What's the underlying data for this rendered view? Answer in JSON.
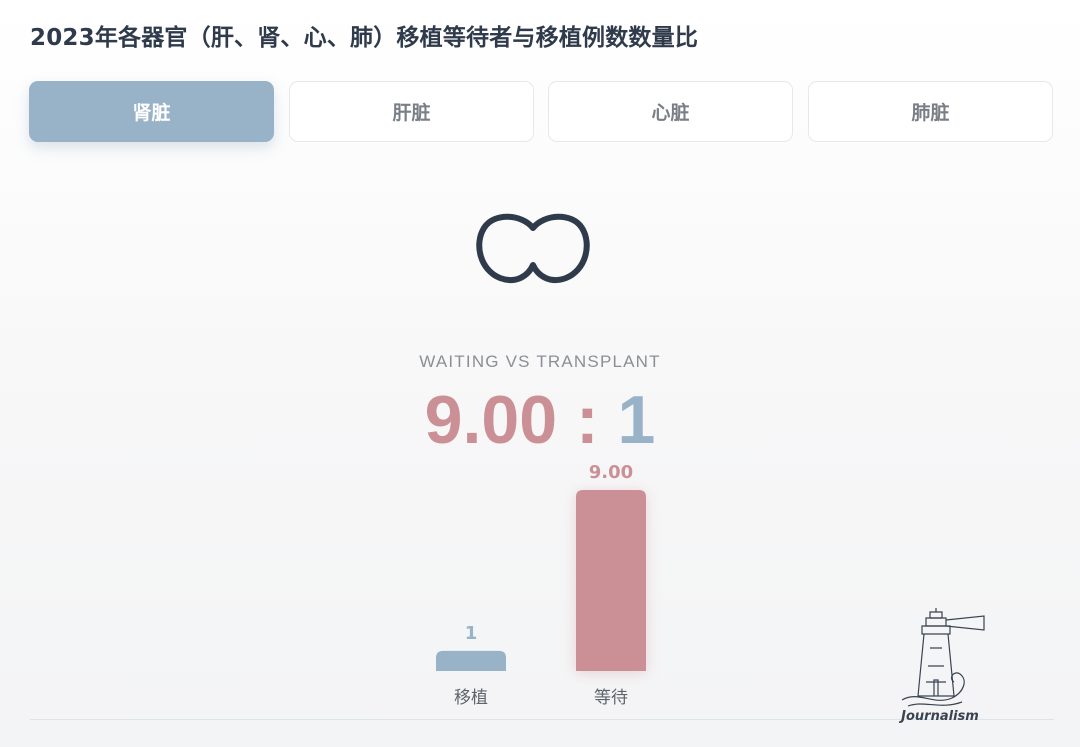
{
  "title": "2023年各器官（肝、肾、心、肺）移植等待者与移植例数数量比",
  "tabs": [
    {
      "label": "肾脏",
      "active": true
    },
    {
      "label": "肝脏",
      "active": false
    },
    {
      "label": "心脏",
      "active": false
    },
    {
      "label": "肺脏",
      "active": false
    }
  ],
  "organ_icon": "kidney-outline-icon",
  "subtitle": "WAITING VS TRANSPLANT",
  "ratio": {
    "waiting": "9.00",
    "separator": ":",
    "transplant": "1"
  },
  "colors": {
    "accent_blue": "#98b2c8",
    "accent_pink": "#cb9096",
    "title_dark": "#2f3a4b",
    "muted_text": "#7a7f86"
  },
  "logo": {
    "icon": "lighthouse-logo",
    "text": "Journalism"
  },
  "chart_data": {
    "type": "bar",
    "categories": [
      "移植",
      "等待"
    ],
    "values": [
      1,
      9.0
    ],
    "value_labels": [
      "1",
      "9.00"
    ],
    "colors": [
      "#98b2c8",
      "#cb9096"
    ],
    "ylim": [
      0,
      9.0
    ],
    "grid": false,
    "legend": "none"
  }
}
